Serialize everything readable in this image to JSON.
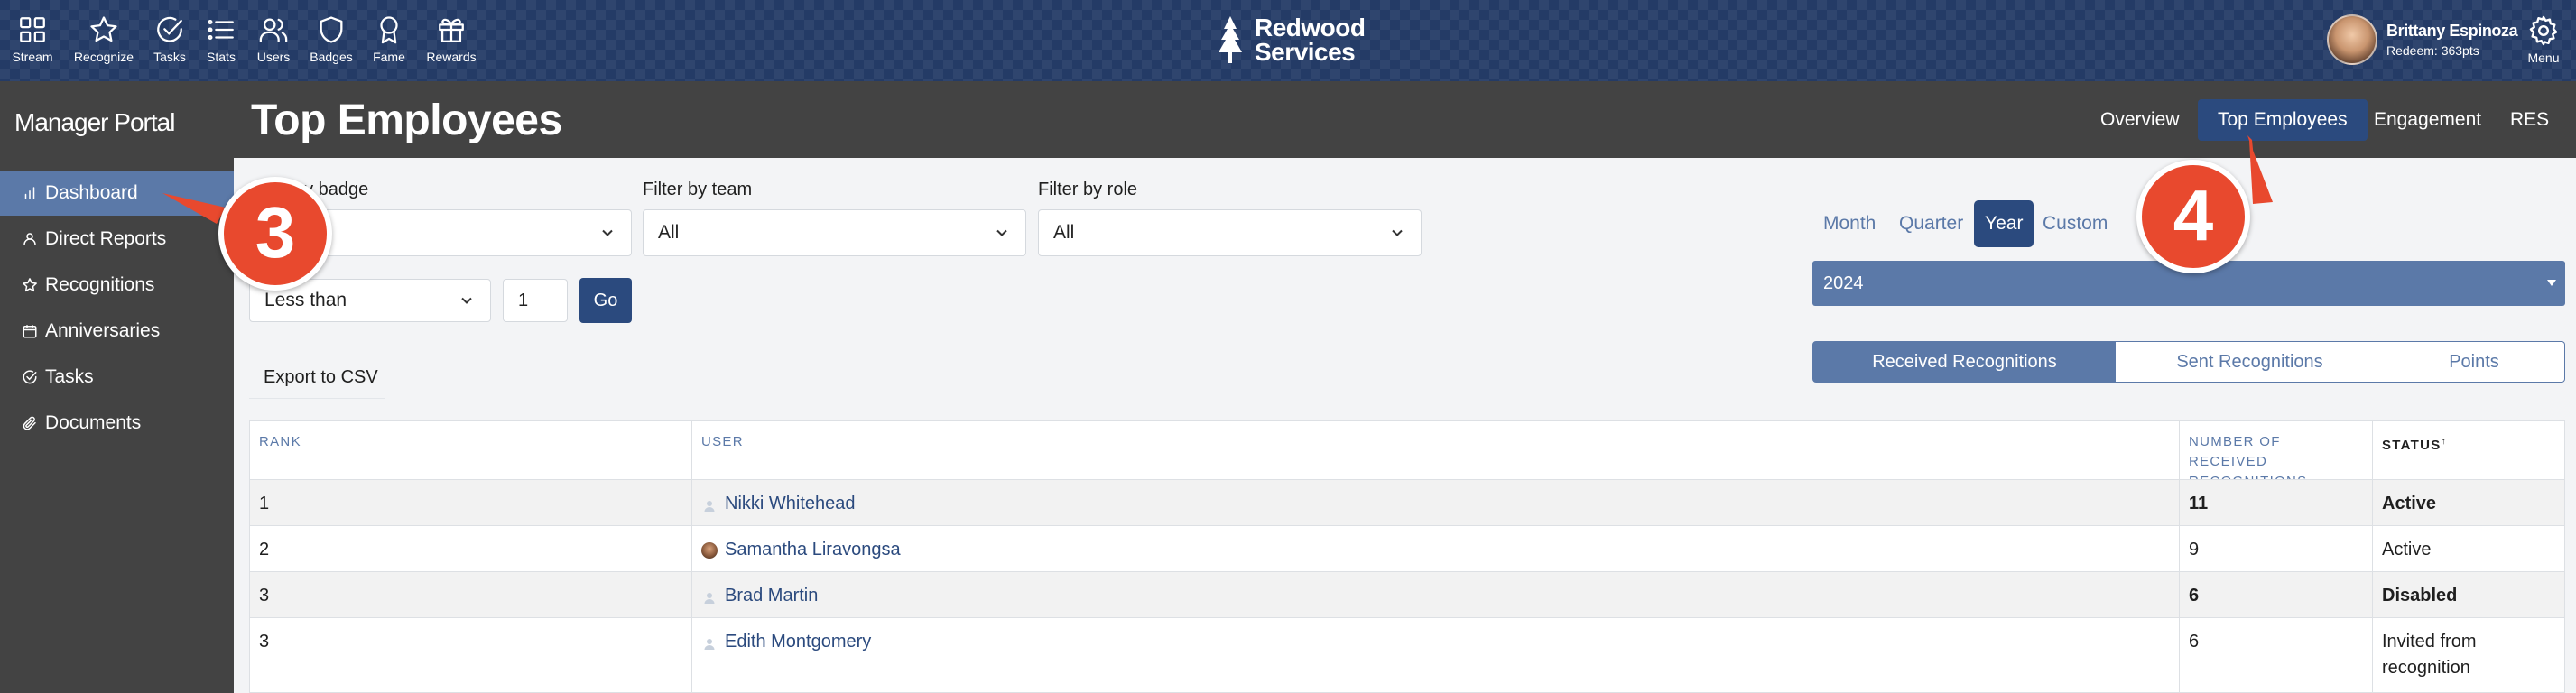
{
  "topnav": {
    "items": [
      {
        "label": "Stream",
        "icon": "grid-icon"
      },
      {
        "label": "Recognize",
        "icon": "star-icon"
      },
      {
        "label": "Tasks",
        "icon": "check-circle-icon"
      },
      {
        "label": "Stats",
        "icon": "list-icon"
      },
      {
        "label": "Users",
        "icon": "users-icon"
      },
      {
        "label": "Badges",
        "icon": "shield-icon"
      },
      {
        "label": "Fame",
        "icon": "award-icon"
      },
      {
        "label": "Rewards",
        "icon": "gift-icon"
      }
    ],
    "logo_line1": "Redwood",
    "logo_line2": "Services",
    "user_name": "Brittany Espinoza",
    "user_points": "Redeem: 363pts",
    "menu_label": "Menu"
  },
  "sidebar": {
    "title": "Manager Portal",
    "items": [
      {
        "label": "Dashboard",
        "icon": "bar-chart-icon",
        "active": true
      },
      {
        "label": "Direct Reports",
        "icon": "person-icon"
      },
      {
        "label": "Recognitions",
        "icon": "star-icon"
      },
      {
        "label": "Anniversaries",
        "icon": "calendar-icon"
      },
      {
        "label": "Tasks",
        "icon": "check-circle-icon"
      },
      {
        "label": "Documents",
        "icon": "paperclip-icon"
      }
    ]
  },
  "header": {
    "title": "Top Employees",
    "tabs": [
      {
        "label": "Overview"
      },
      {
        "label": "Top Employees",
        "active": true
      },
      {
        "label": "Engagement"
      },
      {
        "label": "RES"
      }
    ]
  },
  "filters": {
    "badge_label": "Filter by badge",
    "badge_value": "",
    "team_label": "Filter by team",
    "team_value": "All",
    "role_label": "Filter by role",
    "role_value": "All",
    "comparison_value": "Less than",
    "number_value": "1",
    "go_label": "Go",
    "export_label": "Export to CSV"
  },
  "period": {
    "options": [
      "Month",
      "Quarter",
      "Year",
      "Custom"
    ],
    "selected": "Year",
    "year_value": "2024"
  },
  "metric_tabs": [
    {
      "label": "Received Recognitions",
      "active": true
    },
    {
      "label": "Sent Recognitions"
    },
    {
      "label": "Points"
    }
  ],
  "table": {
    "columns": [
      "RANK",
      "USER",
      "NUMBER OF RECEIVED RECOGNITIONS",
      "STATUS"
    ],
    "status_sort_mark": "↑",
    "rows": [
      {
        "rank": "1",
        "user": "Nikki Whitehead",
        "avatar": "placeholder",
        "count": "11",
        "status": "Active"
      },
      {
        "rank": "2",
        "user": "Samantha Liravongsa",
        "avatar": "photo",
        "count": "9",
        "status": "Active"
      },
      {
        "rank": "3",
        "user": "Brad Martin",
        "avatar": "placeholder",
        "count": "6",
        "status": "Disabled"
      },
      {
        "rank": "3",
        "user": "Edith Montgomery",
        "avatar": "placeholder",
        "count": "6",
        "status": "Invited from recognition"
      }
    ]
  },
  "callouts": [
    "3",
    "4"
  ],
  "colors": {
    "topbar": "#243b66",
    "sidebar": "#434343",
    "accent": "#2b4a7e",
    "accent_light": "#5b79a8",
    "callout": "#e8492e"
  }
}
